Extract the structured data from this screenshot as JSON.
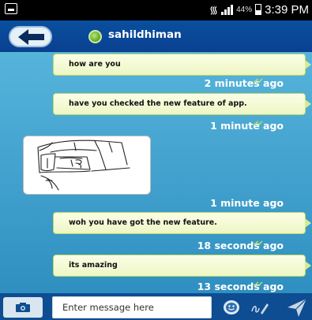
{
  "status_bar": {
    "battery_pct": "44%",
    "time": "3:39 PM"
  },
  "header": {
    "contact_name": "sahildhiman"
  },
  "messages": [
    {
      "type": "text",
      "text": "how are you",
      "time": "2 minutes ago"
    },
    {
      "type": "text",
      "text": "have you checked the new feature of app.",
      "time": "1 minute ago"
    },
    {
      "type": "image",
      "time": "1 minute ago"
    },
    {
      "type": "text",
      "text": "woh you have got the new feature.",
      "time": "18 seconds ago"
    },
    {
      "type": "text",
      "text": "its amazing",
      "time": "13 seconds ago"
    }
  ],
  "composer": {
    "placeholder": "Enter message here"
  },
  "icons": {
    "back": "back-arrow-icon",
    "camera": "camera-icon",
    "emoji": "emoji-icon",
    "doodle": "doodle-icon",
    "send": "send-icon",
    "delivered": "double-check-icon"
  },
  "colors": {
    "header": "#0a4f9f",
    "chat_bg": "#56b4db",
    "bubble": "#f7fbd6",
    "bubble_border": "#b9d86a",
    "ticks": "#b9e06a"
  }
}
